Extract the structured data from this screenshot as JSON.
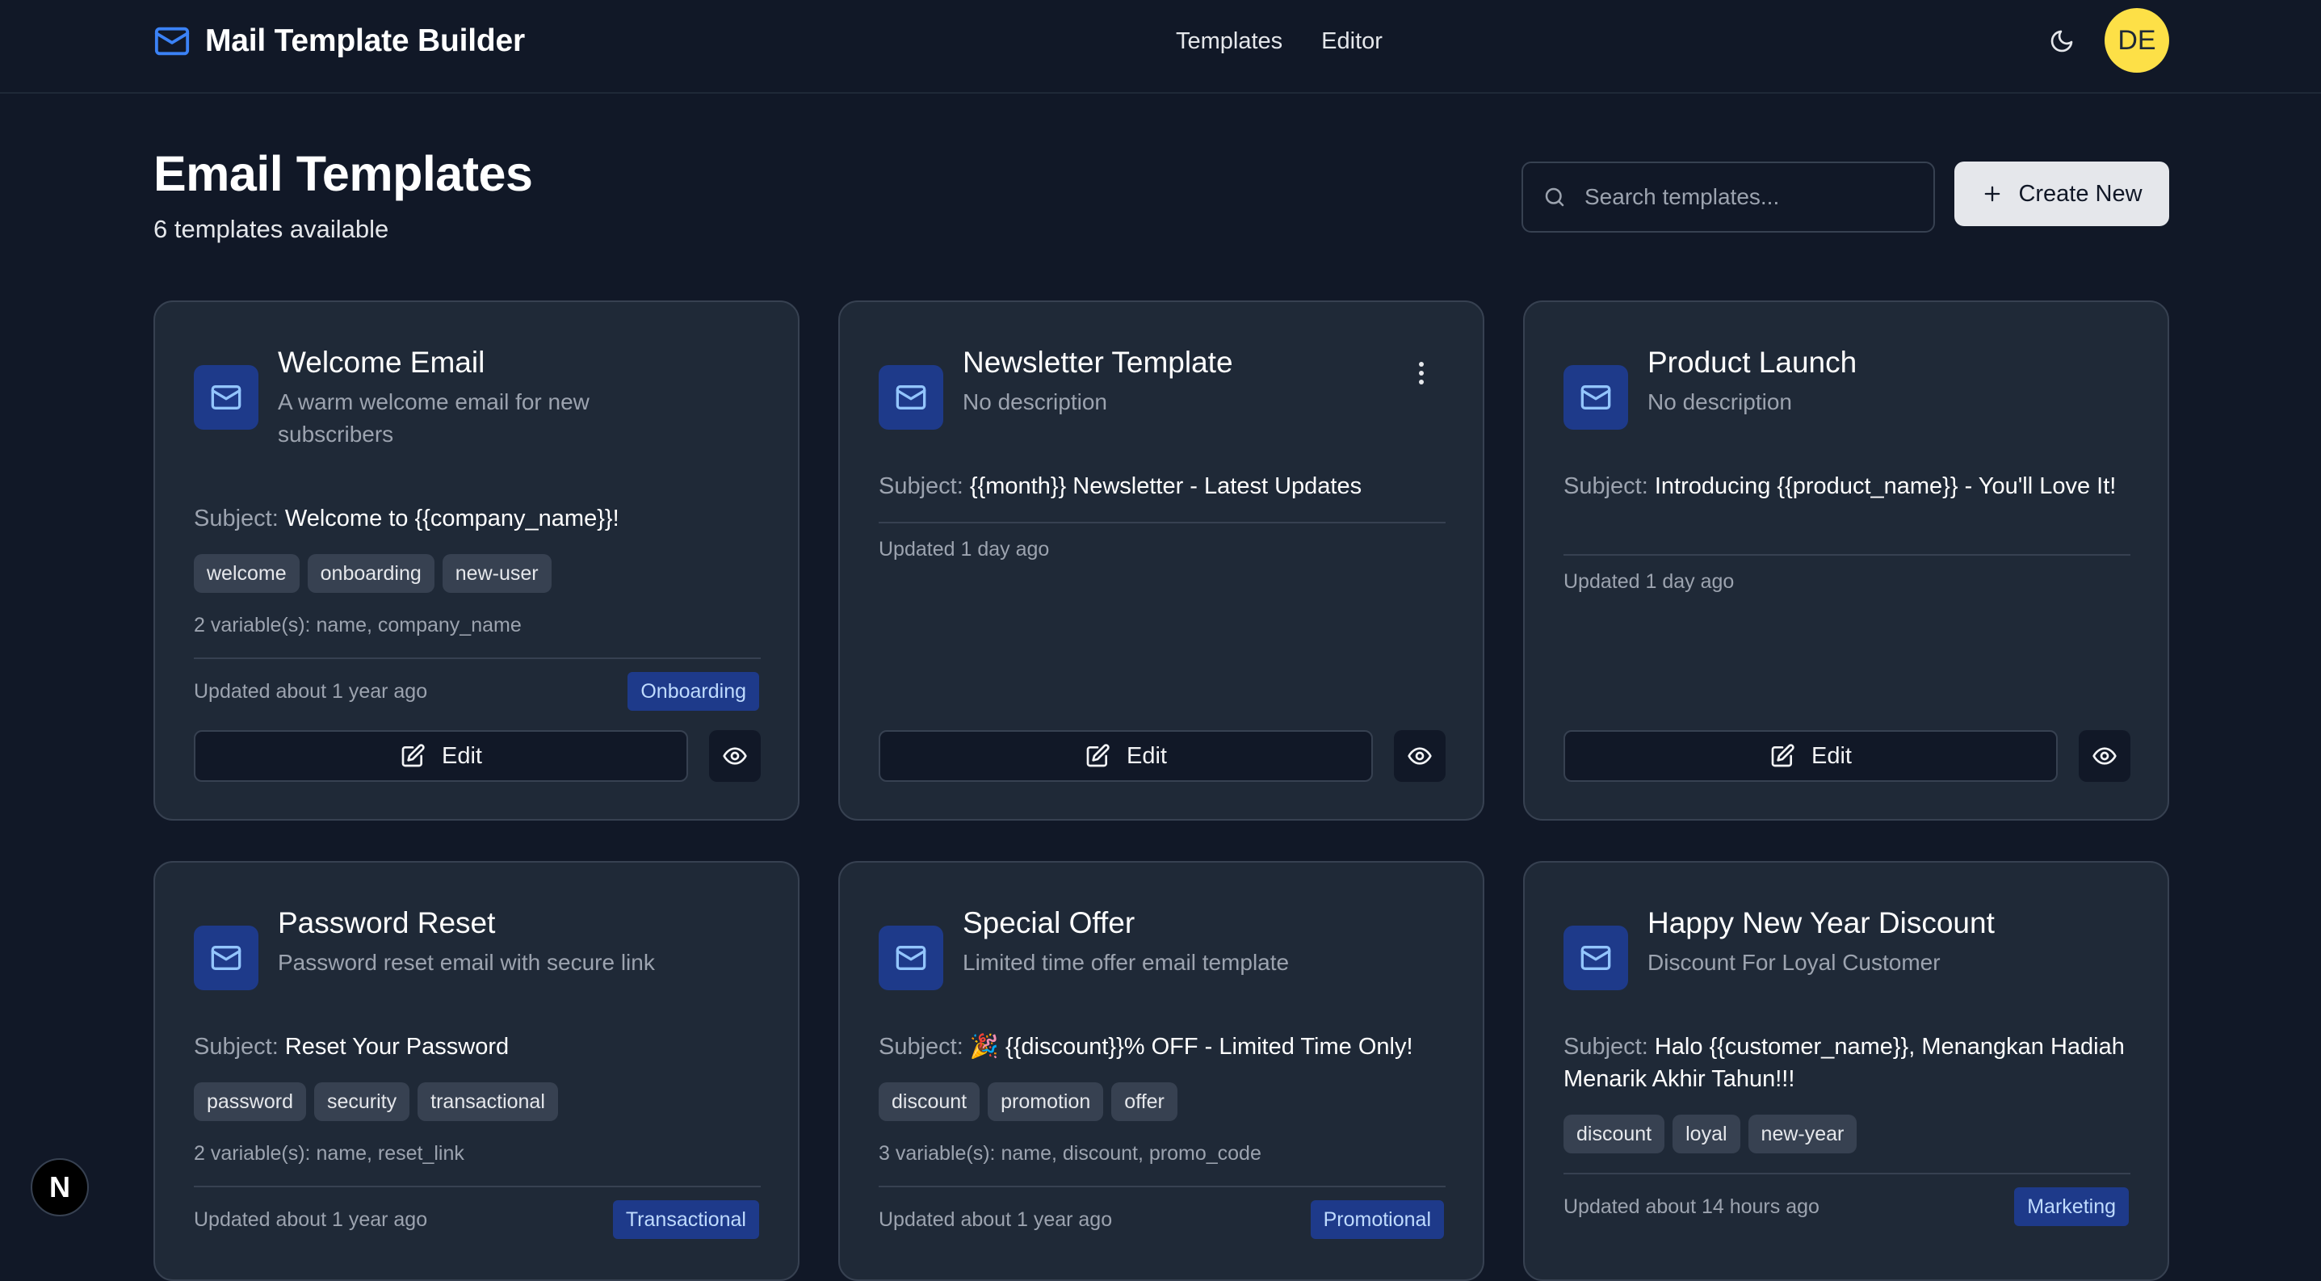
{
  "app": {
    "title": "Mail Template Builder",
    "nav": [
      "Templates",
      "Editor"
    ],
    "avatar_initials": "DE",
    "theme_icon": "moon-icon",
    "floating_badge": "N"
  },
  "page": {
    "title": "Email Templates",
    "subtitle": "6 templates available",
    "search_placeholder": "Search templates...",
    "create_label": "Create New"
  },
  "colors": {
    "background": "#111827",
    "card": "#1f2937",
    "border": "#374151",
    "accent_icon_bg": "#1e3a8a",
    "avatar": "#fde047"
  },
  "labels": {
    "subject_prefix": "Subject:",
    "edit": "Edit"
  },
  "templates": [
    {
      "title": "Welcome Email",
      "description": "A warm welcome email for new subscribers",
      "subject": "Welcome to {{company_name}}!",
      "tags": [
        "welcome",
        "onboarding",
        "new-user"
      ],
      "variables": "2 variable(s): name, company_name",
      "updated": "Updated about 1 year ago",
      "category": "Onboarding"
    },
    {
      "title": "Newsletter Template",
      "description": "No description",
      "subject": "{{month}} Newsletter - Latest Updates",
      "tags": [],
      "variables": "",
      "updated": "Updated 1 day ago",
      "category": ""
    },
    {
      "title": "Product Launch",
      "description": "No description",
      "subject": "Introducing {{product_name}} - You'll Love It!",
      "tags": [],
      "variables": "",
      "updated": "Updated 1 day ago",
      "category": ""
    },
    {
      "title": "Password Reset",
      "description": "Password reset email with secure link",
      "subject": "Reset Your Password",
      "tags": [
        "password",
        "security",
        "transactional"
      ],
      "variables": "2 variable(s): name, reset_link",
      "updated": "Updated about 1 year ago",
      "category": "Transactional"
    },
    {
      "title": "Special Offer",
      "description": "Limited time offer email template",
      "subject": "🎉 {{discount}}% OFF - Limited Time Only!",
      "tags": [
        "discount",
        "promotion",
        "offer"
      ],
      "variables": "3 variable(s): name, discount, promo_code",
      "updated": "Updated about 1 year ago",
      "category": "Promotional"
    },
    {
      "title": "Happy New Year Discount",
      "description": "Discount For Loyal Customer",
      "subject": "Halo {{customer_name}}, Menangkan Hadiah Menarik Akhir Tahun!!!",
      "tags": [
        "discount",
        "loyal",
        "new-year"
      ],
      "variables": "",
      "updated": "Updated about 14 hours ago",
      "category": "Marketing"
    }
  ]
}
